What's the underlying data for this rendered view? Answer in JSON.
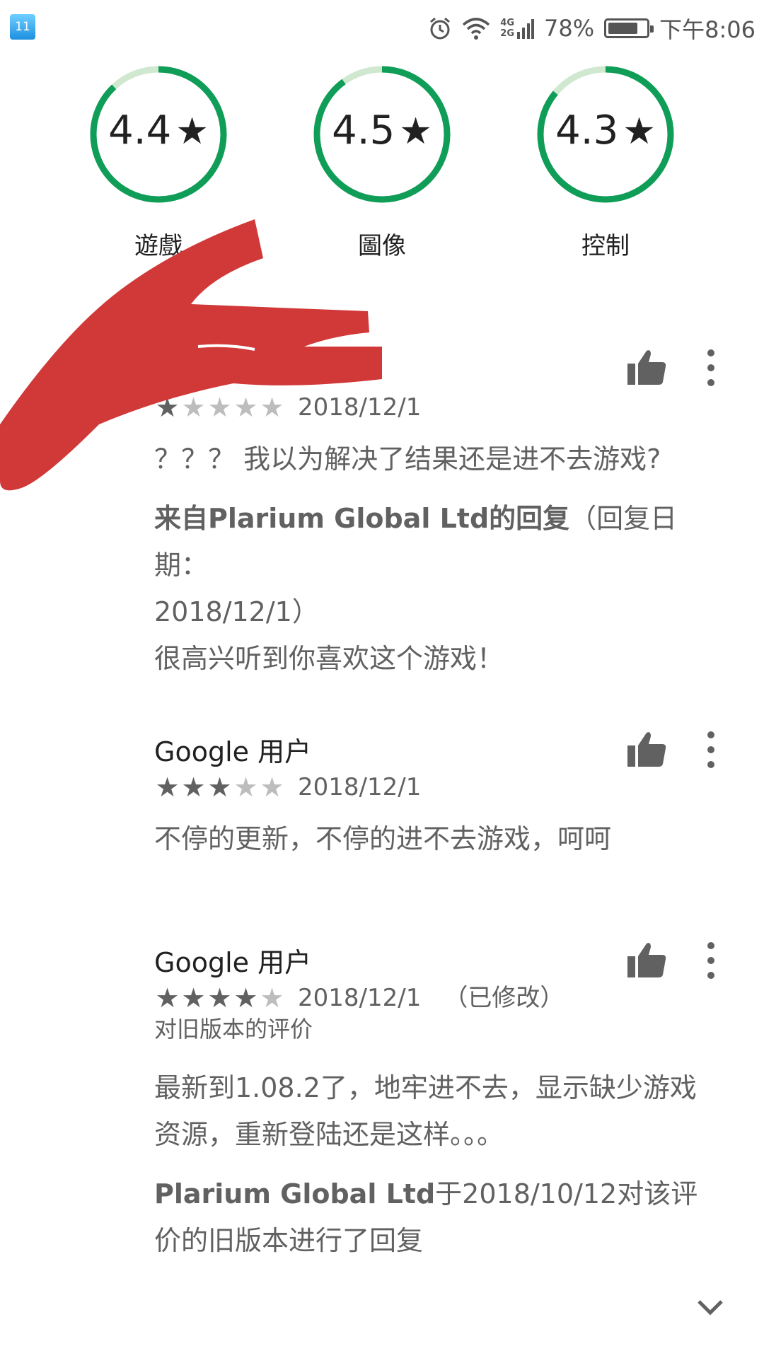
{
  "status_bar": {
    "notification_label": "11",
    "network_top": "4G",
    "network_bottom": "2G",
    "battery_percent": "78%",
    "battery_level": 0.78,
    "time": "下午8:06"
  },
  "ratings": [
    {
      "value": "4.4",
      "label": "遊戲",
      "score": 4.4
    },
    {
      "value": "4.5",
      "label": "圖像",
      "score": 4.5
    },
    {
      "value": "4.3",
      "label": "控制",
      "score": 4.3
    }
  ],
  "star_glyph": "★",
  "reviews": [
    {
      "name": "",
      "stars": 1,
      "date": "2018/12/1",
      "text": "？？？ 我以为解决了结果还是进不去游戏?",
      "reply_header_bold": "来自Plarium Global Ltd的回复",
      "reply_header_rest": "（回复日期：",
      "reply_date": "2018/12/1）",
      "reply_text": "很高兴听到你喜欢这个游戏！"
    },
    {
      "name": "Google 用户",
      "stars": 3,
      "date": "2018/12/1",
      "text": "不停的更新，不停的进不去游戏，呵呵"
    },
    {
      "name": "Google 用户",
      "stars": 4,
      "date": "2018/12/1",
      "edited": "（已修改）",
      "older_version": "对旧版本的评价",
      "text": "最新到1.08.2了，地牢进不去，显示缺少游戏资源，重新登陆还是这样。。。",
      "reply_bold": "Plarium Global Ltd",
      "reply_rest": "于2018/10/12对该评价的旧版本进行了回复"
    }
  ],
  "colors": {
    "ring": "#0f9d58",
    "ring_track": "#cfe8cf",
    "scribble": "#d13838"
  },
  "icons": [
    "thumbs-up-icon",
    "more-vert-icon",
    "chevron-down-icon",
    "alarm-icon",
    "wifi-icon",
    "battery-icon"
  ]
}
